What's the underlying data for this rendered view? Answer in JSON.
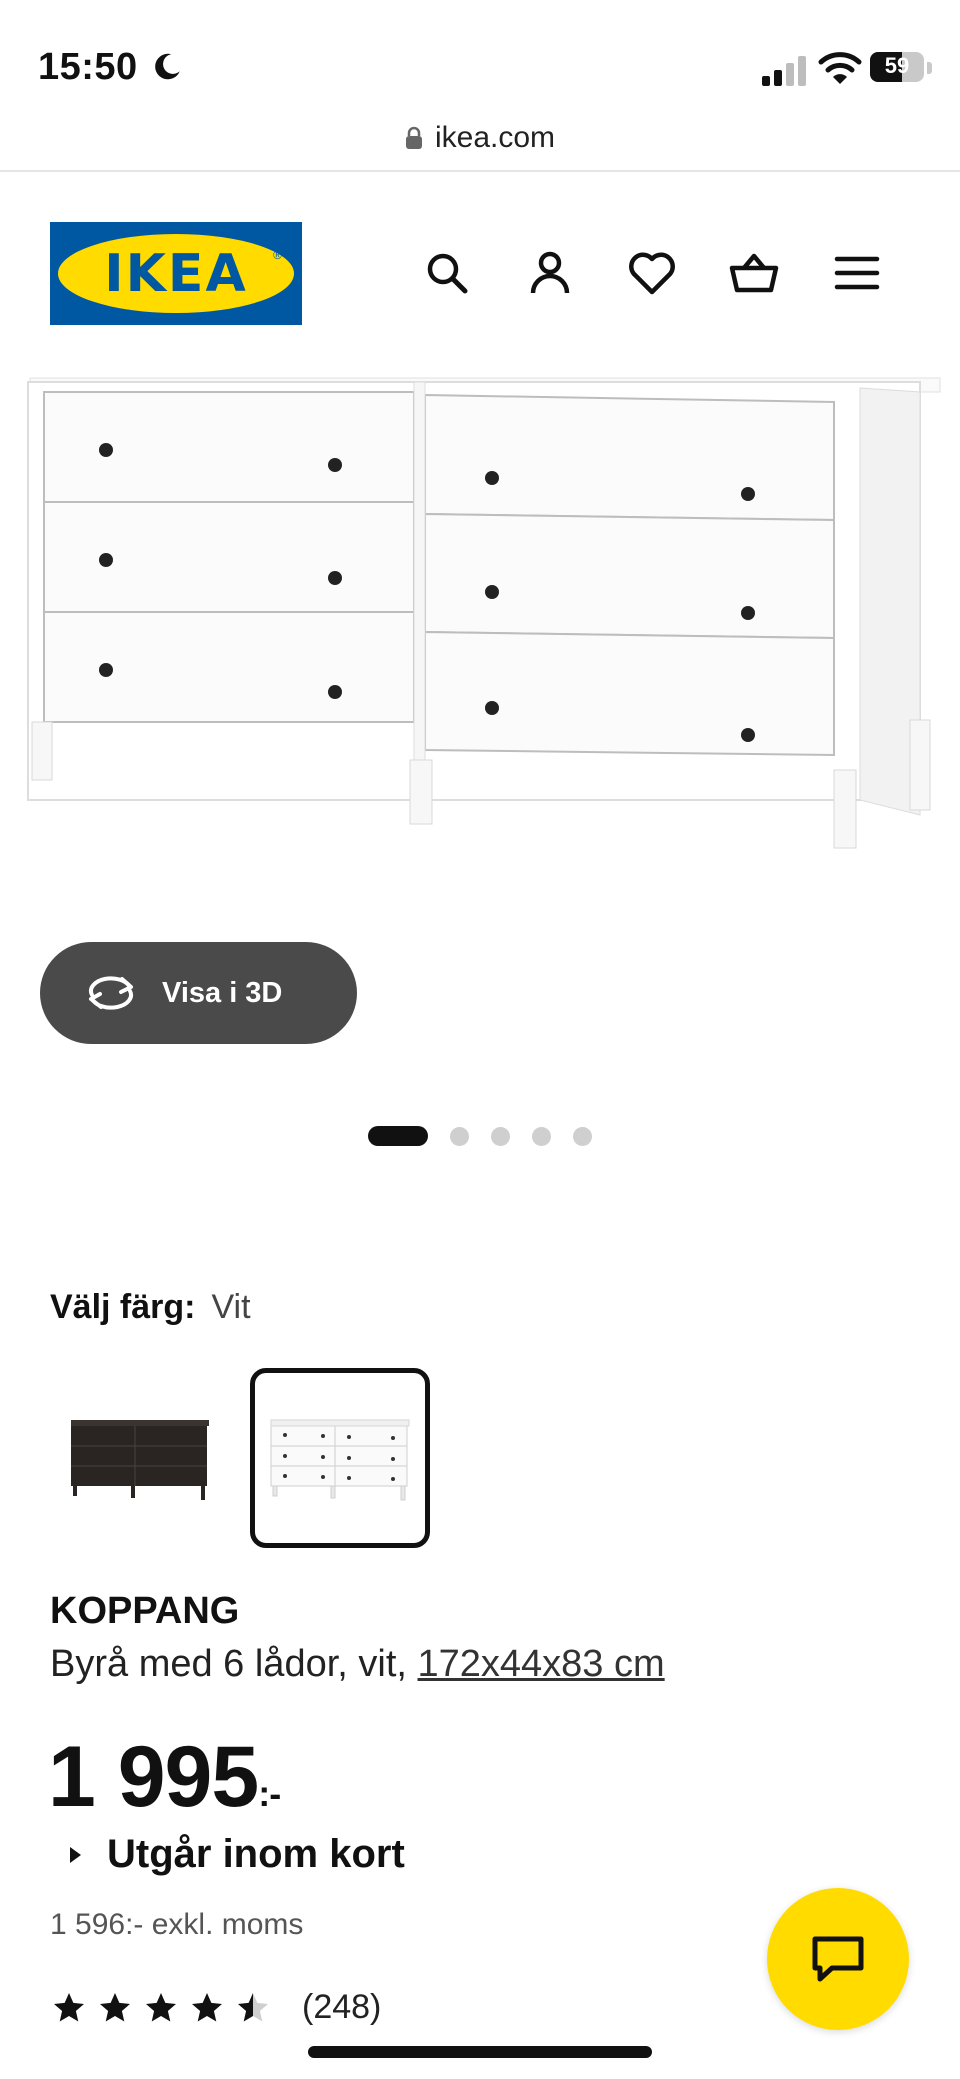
{
  "status_bar": {
    "time": "15:50",
    "battery": "59",
    "battery_level": 0.59
  },
  "browser": {
    "url": "ikea.com"
  },
  "header": {
    "logo_text": "IKEA",
    "logo_registered": "®",
    "icons": [
      "search-icon",
      "account-icon",
      "favorites-heart-icon",
      "shopping-basket-icon",
      "menu-icon"
    ],
    "colors": {
      "ikea_blue": "#0058a3",
      "ikea_yellow": "#ffdb00"
    }
  },
  "gallery": {
    "view_3d_label": "Visa i 3D",
    "image_count": 5,
    "active_index": 0
  },
  "color_picker": {
    "label": "Välj färg:",
    "selected_value": "Vit",
    "options": [
      "black-brown",
      "white"
    ],
    "selected_index": 1
  },
  "product": {
    "name": "KOPPANG",
    "description": "Byrå med 6 lådor, vit,",
    "dimensions": "172x44x83 cm",
    "price": "1 995",
    "price_suffix": ":-",
    "availability": "Utgår inom kort",
    "price_ex_vat": "1 596:- exkl. moms",
    "rating": 4.5,
    "rating_max": 5,
    "review_count": "(248)"
  }
}
